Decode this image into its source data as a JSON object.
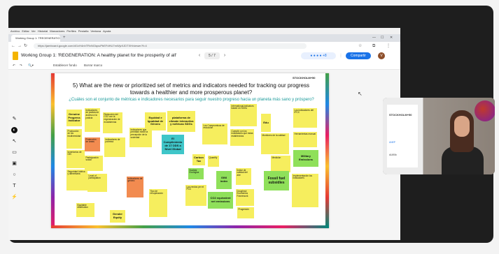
{
  "browser": {
    "menu": [
      "Archivo",
      "Editar",
      "Ver",
      "Historial",
      "Marcadores",
      "Perfiles",
      "Pestaña",
      "Ventana",
      "Ayuda"
    ],
    "tab_label": "Working Group 1: TREGENERATIO",
    "url": "https://jamboard.google.com/d/1vH4nhTRvNGlqxuPbEFdHU7mWjvXJDTXH/viewer?f=4"
  },
  "app": {
    "title": "Working Group 1: 'REGENERATION: A healthy planet for the prosperity of all'",
    "frame_counter": "5 / 7",
    "share_label": "Compartir",
    "avatar_initial": "V",
    "toolbar": {
      "clear_frame": "Establecer fondo",
      "erase_frame": "Borrar marco"
    }
  },
  "slide": {
    "logo_text": "STOCKHOLM+50",
    "question_en": "5)    What are the new or prioritized set of metrics and indicators needed for tracking our progress towards a healthier and more prosperous planet?",
    "question_es": "¿Cuáles son el conjunto de métricas e indicadores necesarios para seguir nuestro progreso hacia un planeta más sano y próspero?",
    "notes": [
      {
        "text": "Genuine Progress Indicator",
        "color": "#f6ee5e",
        "style": "mid"
      },
      {
        "text": "Indicadores de justicia de acceso a la justicia",
        "color": "#f6ee5e",
        "style": "small"
      },
      {
        "text": "Reducción del CO2 con la regeneración de ecosistemas",
        "color": "#f6ee5e",
        "style": "small"
      },
      {
        "text": "Equidad e Igualdad de Género",
        "color": "#f6ee5e",
        "style": "mid"
      },
      {
        "text": "plataforma de climate interactiva y métricas SDGs",
        "color": "#f6ee5e",
        "style": "mid"
      },
      {
        "text": "Indicadores que permitan medir la percepción de la sociedad",
        "color": "#f6ee5e",
        "style": "small"
      },
      {
        "text": "International indicators based on SDGs",
        "color": "#f6ee5e",
        "style": "small"
      },
      {
        "text": "Edu",
        "color": "#f6ee5e",
        "style": "mid"
      },
      {
        "text": "Los indicadores del IPCC",
        "color": "#f6ee5e",
        "style": "small"
      },
      {
        "text": "Herramientas manual",
        "color": "#f6ee5e",
        "style": "small"
      },
      {
        "text": "Producción de los biodiversidad",
        "color": "#f6ee5e",
        "style": "small"
      },
      {
        "text": "Inventarios de GEI",
        "color": "#f6ee5e",
        "style": "small"
      },
      {
        "text": "Protección de áreas",
        "color": "#f28b50",
        "style": "small"
      },
      {
        "text": "Participación social",
        "color": "#f6ee5e",
        "style": "small"
      },
      {
        "text": "Indicadores de pobreza",
        "color": "#f6ee5e",
        "style": "small"
      },
      {
        "text": "El Cumplimiento de 17 ODS a Nivel Global",
        "color": "#3fc6c9",
        "style": "mid"
      },
      {
        "text": "Los Compromisos de reducción",
        "color": "#f6ee5e",
        "style": "small"
      },
      {
        "text": "Cumplir con los indicadores que estas establecidos",
        "color": "#f6ee5e",
        "style": "small"
      },
      {
        "text": "Monitoreo de la calidad",
        "color": "#f6ee5e",
        "style": "small"
      },
      {
        "text": "Medición",
        "color": "#f6ee5e",
        "style": "small"
      },
      {
        "text": "Military Emissions",
        "color": "#8fe05a",
        "style": "mid"
      },
      {
        "text": "Seguridad hídrica y alimentaria",
        "color": "#f6ee5e",
        "style": "small"
      },
      {
        "text": "Level of participation",
        "color": "#f6ee5e",
        "style": "small"
      },
      {
        "text": "Carbon Tax",
        "color": "#f6ee5e",
        "style": "mid"
      },
      {
        "text": "Nuclear Ecológica",
        "color": "#8fe05a",
        "style": "small"
      },
      {
        "text": "Quantify",
        "color": "#f6ee5e",
        "style": "small"
      },
      {
        "text": "GINI index",
        "color": "#8fe05a",
        "style": "mid"
      },
      {
        "text": "Índice de calidad del aire",
        "color": "#f6ee5e",
        "style": "small"
      },
      {
        "text": "Fossil fuel subsidies",
        "color": "#8fe05a",
        "style": "big"
      },
      {
        "text": "CO2 equivalent net emissions",
        "color": "#8fe05a",
        "style": "mid"
      },
      {
        "text": "Los rendos per el PCC",
        "color": "#f6ee5e",
        "style": "small"
      },
      {
        "text": "Doughnut Economics Framework",
        "color": "#f6ee5e",
        "style": "small"
      },
      {
        "text": "Implementación los indicadores",
        "color": "#f6ee5e",
        "style": "small"
      },
      {
        "text": "Equitable distribution",
        "color": "#f6ee5e",
        "style": "small"
      },
      {
        "text": "Gender Equity",
        "color": "#f6ee5e",
        "style": "mid"
      },
      {
        "text": "Indicadores de género",
        "color": "#f28b50",
        "style": "small"
      },
      {
        "text": "Tipo de recuperación",
        "color": "#f6ee5e",
        "style": "small"
      },
      {
        "text": "Progresión",
        "color": "#f6ee5e",
        "style": "small"
      }
    ]
  },
  "video": {
    "poster_title": "STOCKHOLM+50",
    "poster_sub": "UNEP",
    "poster_url": "#1490b"
  }
}
